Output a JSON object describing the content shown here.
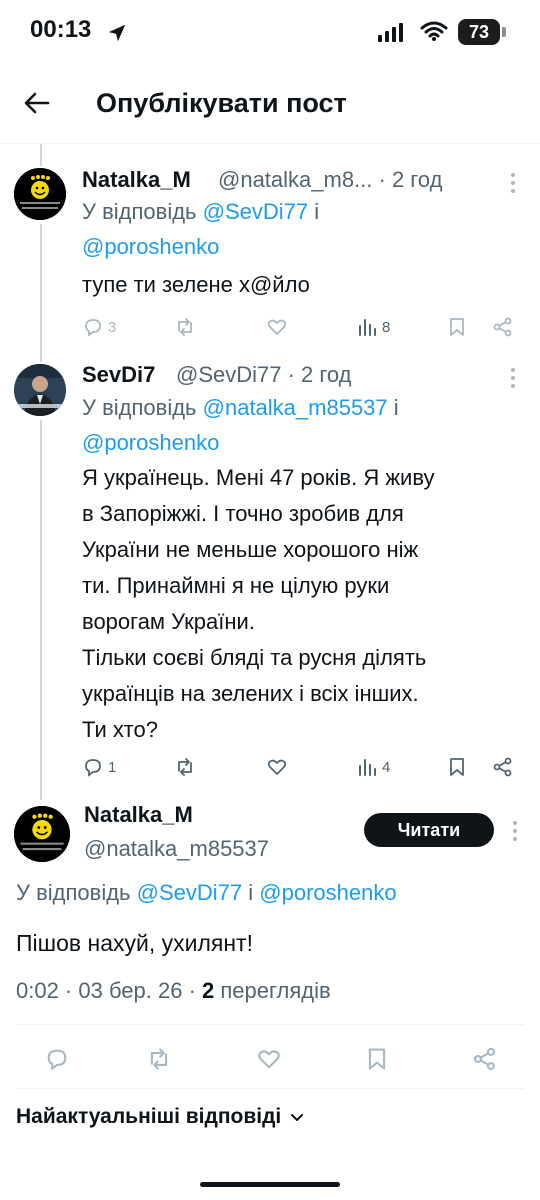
{
  "status": {
    "time": "00:13",
    "battery": "73"
  },
  "header": {
    "title": "Опублікувати пост"
  },
  "tweets": [
    {
      "name": "Natalka_M",
      "handle": "@natalka_m8... · 2 год",
      "reply_prefix": "У відповідь ",
      "reply_mention1": "@SevDi77",
      "reply_and": " і",
      "reply_mention2": "@poroshenko",
      "lines": [
        "тупе ти зелене х@йло"
      ],
      "replies": "3",
      "views": "8"
    },
    {
      "name": "SevDi7",
      "handle": "@SevDi77 · 2 год",
      "reply_prefix": "У відповідь ",
      "reply_mention1": "@natalka_m85537",
      "reply_and": " і",
      "reply_mention2": "@poroshenko",
      "lines": [
        "Я українець. Мені 47 років. Я живу",
        "в Запоріжжі. І  точно зробив для",
        "України не меньше хорошого ніж",
        "ти. Принаймні я не цілую руки",
        "ворогам України.",
        "Тільки соєві бляді та русня ділять",
        "українців на зелених і всіх інших.",
        "Ти хто?"
      ],
      "replies": "1",
      "views": "4"
    }
  ],
  "main": {
    "name": "Natalka_M",
    "handle": "@natalka_m85537",
    "follow_label": "Читати",
    "reply_prefix": "У відповідь ",
    "reply_mention1": "@SevDi77",
    "reply_and": " і ",
    "reply_mention2": "@poroshenko",
    "text": "Пішов нахуй, ухилянт!",
    "timestamp": "0:02 · 03 бер. 26 · ",
    "views_count": "2",
    "views_label": " переглядів"
  },
  "sort": {
    "label": "Найактуальніші відповіді"
  },
  "colors": {
    "accent": "#1d9bf0",
    "text": "#0f1419",
    "secondary": "#536471"
  }
}
